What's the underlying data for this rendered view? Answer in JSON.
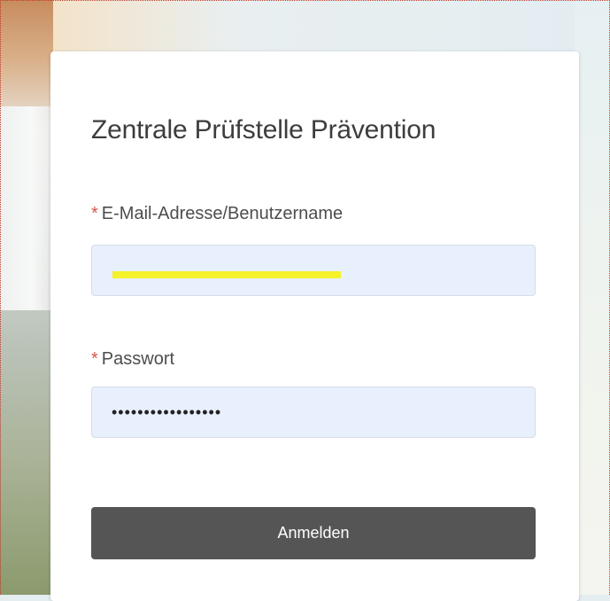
{
  "login": {
    "title": "Zentrale Prüfstelle Prävention",
    "required_marker": "*",
    "email_label": "E-Mail-Adresse/Benutzername",
    "email_value": "",
    "password_label": "Passwort",
    "password_value": "•••••••••••••••••",
    "submit_label": "Anmelden"
  },
  "colors": {
    "button_bg": "#555555",
    "input_bg": "#e8f0fe",
    "required": "#d9534f",
    "highlight": "#f5f22a"
  }
}
